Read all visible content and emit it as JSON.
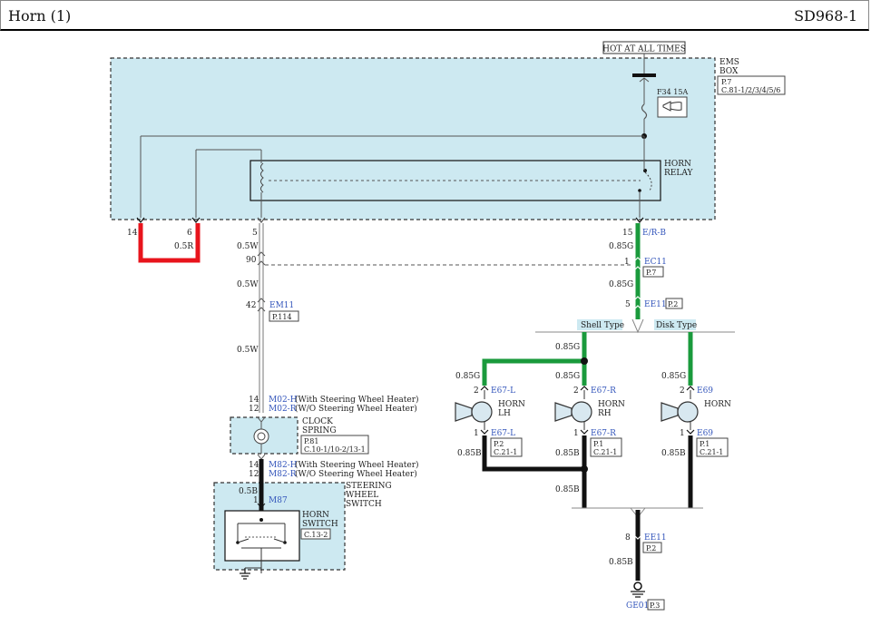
{
  "header": {
    "title": "Horn (1)",
    "code": "SD968-1"
  },
  "power": {
    "label": "HOT AT ALL TIMES"
  },
  "ems_box": {
    "title_1": "EMS",
    "title_2": "BOX",
    "page": "P.7",
    "conn": "C.81-1/2/3/4/5/6",
    "fuse": "F34 15A"
  },
  "relay": {
    "line1": "HORN",
    "line2": "RELAY"
  },
  "pins": {
    "p14": "14",
    "p6": "6",
    "p5": "5",
    "p15": "15"
  },
  "wires": {
    "w05R": "0.5R",
    "w05W": "0.5W",
    "w085G": "0.85G",
    "w085B": "0.85B",
    "w05B": "0.5B",
    "erb": "E/R-B"
  },
  "connectors": {
    "n90": "90",
    "n1": "1",
    "n42": "42",
    "n5": "5",
    "n14": "14",
    "n12": "12",
    "n2": "2",
    "n8": "8",
    "ec11": "EC11",
    "ec11_page": "P.7",
    "em11": "EM11",
    "em11_page": "P.114",
    "ee11": "EE11",
    "ee11_page": "P.2",
    "m02h": "M02-H",
    "m02h_desc": "(With Steering Wheel Heater)",
    "m02r": "M02-R",
    "m02r_desc": "(W/O Steering Wheel Heater)",
    "m82h": "M82-H",
    "m82h_desc": "(With Steering Wheel Heater)",
    "m82r": "M82-R",
    "m82r_desc": "(W/O Steering Wheel Heater)",
    "m87": "M87",
    "e67l": "E67-L",
    "e67r": "E67-R",
    "e69": "E69",
    "ee11b": "EE11",
    "ee11b_page": "P.2",
    "ge01": "GE01",
    "ge01_page": "P.3"
  },
  "clock_spring": {
    "line1": "CLOCK",
    "line2": "SPRING",
    "page": "P.81",
    "conn": "C.10-1/10-2/13-1"
  },
  "steering": {
    "line1": "STEERING",
    "line2": "WHEEL",
    "line3": "SWITCH",
    "sw1": "HORN",
    "sw2": "SWITCH",
    "conn": "C.13-2"
  },
  "types": {
    "shell": "Shell Type",
    "disk": "Disk Type"
  },
  "horns": {
    "lh1": "HORN",
    "lh2": "LH",
    "lh_page": "P.2",
    "lh_conn": "C.21-1",
    "rh1": "HORN",
    "rh2": "RH",
    "rh_page": "P.1",
    "rh_conn": "C.21-1",
    "h1": "HORN",
    "h_page": "P.1",
    "h_conn": "C.21-1"
  },
  "colors": {
    "green": "#1a9a3c",
    "red": "#e8141c",
    "blue_fill": "#cde9f1",
    "link": "#3355bb"
  }
}
